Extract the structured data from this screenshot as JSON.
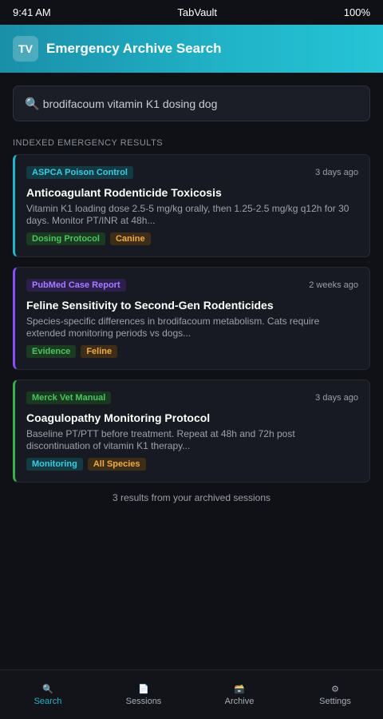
{
  "status_bar": {
    "time": "9:41 AM",
    "carrier": "TabVault",
    "battery": "100%"
  },
  "header": {
    "logo": "TV",
    "title": "Emergency Archive Search"
  },
  "search": {
    "icon": "search-icon",
    "value": "brodifacoum vitamin K1 dosing dog"
  },
  "section_title": "INDEXED EMERGENCY RESULTS",
  "results": [
    {
      "source": "ASPCA Poison Control",
      "time": "3 days ago",
      "title": "Anticoagulant Rodenticide Toxicosis",
      "description": "Vitamin K1 loading dose 2.5-5 mg/kg orally, then 1.25-2.5 mg/kg q12h for 30 days. Monitor PT/INR at 48h...",
      "tags": [
        "Dosing Protocol",
        "Canine"
      ],
      "accent": "#20b4c8"
    },
    {
      "source": "PubMed Case Report",
      "time": "2 weeks ago",
      "title": "Feline Sensitivity to Second-Gen Rodenticides",
      "description": "Species-specific differences in brodifacoum metabolism. Cats require extended monitoring periods vs dogs...",
      "tags": [
        "Evidence",
        "Feline"
      ],
      "accent": "#8a4cff"
    },
    {
      "source": "Merck Vet Manual",
      "time": "3 days ago",
      "title": "Coagulopathy Monitoring Protocol",
      "description": "Baseline PT/PTT before treatment. Repeat at 48h and 72h post discontinuation of vitamin K1 therapy...",
      "tags": [
        "Monitoring",
        "All Species"
      ],
      "accent": "#35b24a"
    }
  ],
  "footer_note": "3 results from your archived sessions",
  "nav": {
    "items": [
      {
        "icon": "search-icon",
        "glyph": "🔍",
        "label": "Search",
        "active": true
      },
      {
        "icon": "document-icon",
        "glyph": "📄",
        "label": "Sessions",
        "active": false
      },
      {
        "icon": "archive-box-icon",
        "glyph": "🗃️",
        "label": "Archive",
        "active": false
      },
      {
        "icon": "gear-icon",
        "glyph": "⚙",
        "label": "Settings",
        "active": false
      }
    ]
  }
}
